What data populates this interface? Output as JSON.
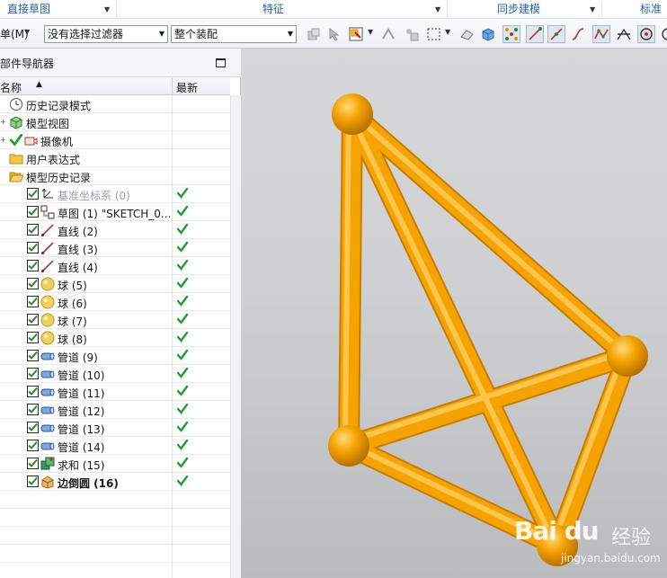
{
  "ribbon": {
    "groups": [
      "直接草图",
      "特征",
      "同步建模",
      "标准件"
    ]
  },
  "toolbar": {
    "menu_label": "单(M)",
    "filter_value": "没有选择过滤器",
    "assembly_value": "整个装配"
  },
  "navigator": {
    "title": "部件导航器",
    "columns": {
      "name": "名称",
      "latest": "最新"
    },
    "rows": [
      {
        "label": "历史记录模式",
        "icon": "clock-icon",
        "style": "normal",
        "latest": false
      },
      {
        "label": "模型视图",
        "icon": "model-views-icon",
        "style": "normal",
        "latest": false
      },
      {
        "label": "摄像机",
        "icon": "camera-icon",
        "style": "normal",
        "latest": false
      },
      {
        "label": "用户表达式",
        "icon": "folder-icon",
        "style": "normal",
        "latest": false
      },
      {
        "label": "模型历史记录",
        "icon": "open-folder-icon",
        "style": "normal",
        "latest": false
      },
      {
        "label": "基准坐标系 (0)",
        "icon": "datum-csys-icon",
        "style": "gray",
        "latest": true
      },
      {
        "label": "草图 (1) \"SKETCH_0...",
        "icon": "sketch-icon",
        "style": "normal",
        "latest": true
      },
      {
        "label": "直线 (2)",
        "icon": "line-icon",
        "style": "normal",
        "latest": true
      },
      {
        "label": "直线 (3)",
        "icon": "line-icon",
        "style": "normal",
        "latest": true
      },
      {
        "label": "直线 (4)",
        "icon": "line-icon",
        "style": "normal",
        "latest": true
      },
      {
        "label": "球 (5)",
        "icon": "sphere-icon",
        "style": "normal",
        "latest": true
      },
      {
        "label": "球 (6)",
        "icon": "sphere-icon",
        "style": "normal",
        "latest": true
      },
      {
        "label": "球 (7)",
        "icon": "sphere-icon",
        "style": "normal",
        "latest": true
      },
      {
        "label": "球 (8)",
        "icon": "sphere-icon",
        "style": "normal",
        "latest": true
      },
      {
        "label": "管道 (9)",
        "icon": "tube-icon",
        "style": "normal",
        "latest": true
      },
      {
        "label": "管道 (10)",
        "icon": "tube-icon",
        "style": "normal",
        "latest": true
      },
      {
        "label": "管道 (11)",
        "icon": "tube-icon",
        "style": "normal",
        "latest": true
      },
      {
        "label": "管道 (12)",
        "icon": "tube-icon",
        "style": "normal",
        "latest": true
      },
      {
        "label": "管道 (13)",
        "icon": "tube-icon",
        "style": "normal",
        "latest": true
      },
      {
        "label": "管道 (14)",
        "icon": "tube-icon",
        "style": "normal",
        "latest": true
      },
      {
        "label": "求和 (15)",
        "icon": "unite-icon",
        "style": "normal",
        "latest": true
      },
      {
        "label": "边倒圆 (16)",
        "icon": "edge-blend-icon",
        "style": "bold",
        "latest": true
      }
    ]
  },
  "watermark": {
    "brand": "Bai du",
    "brand_cn": "经验",
    "url": "jingyan.baidu.com"
  },
  "colors": {
    "model": "#f5a300",
    "accent": "#2a62a8",
    "check": "#1f9e2a"
  }
}
